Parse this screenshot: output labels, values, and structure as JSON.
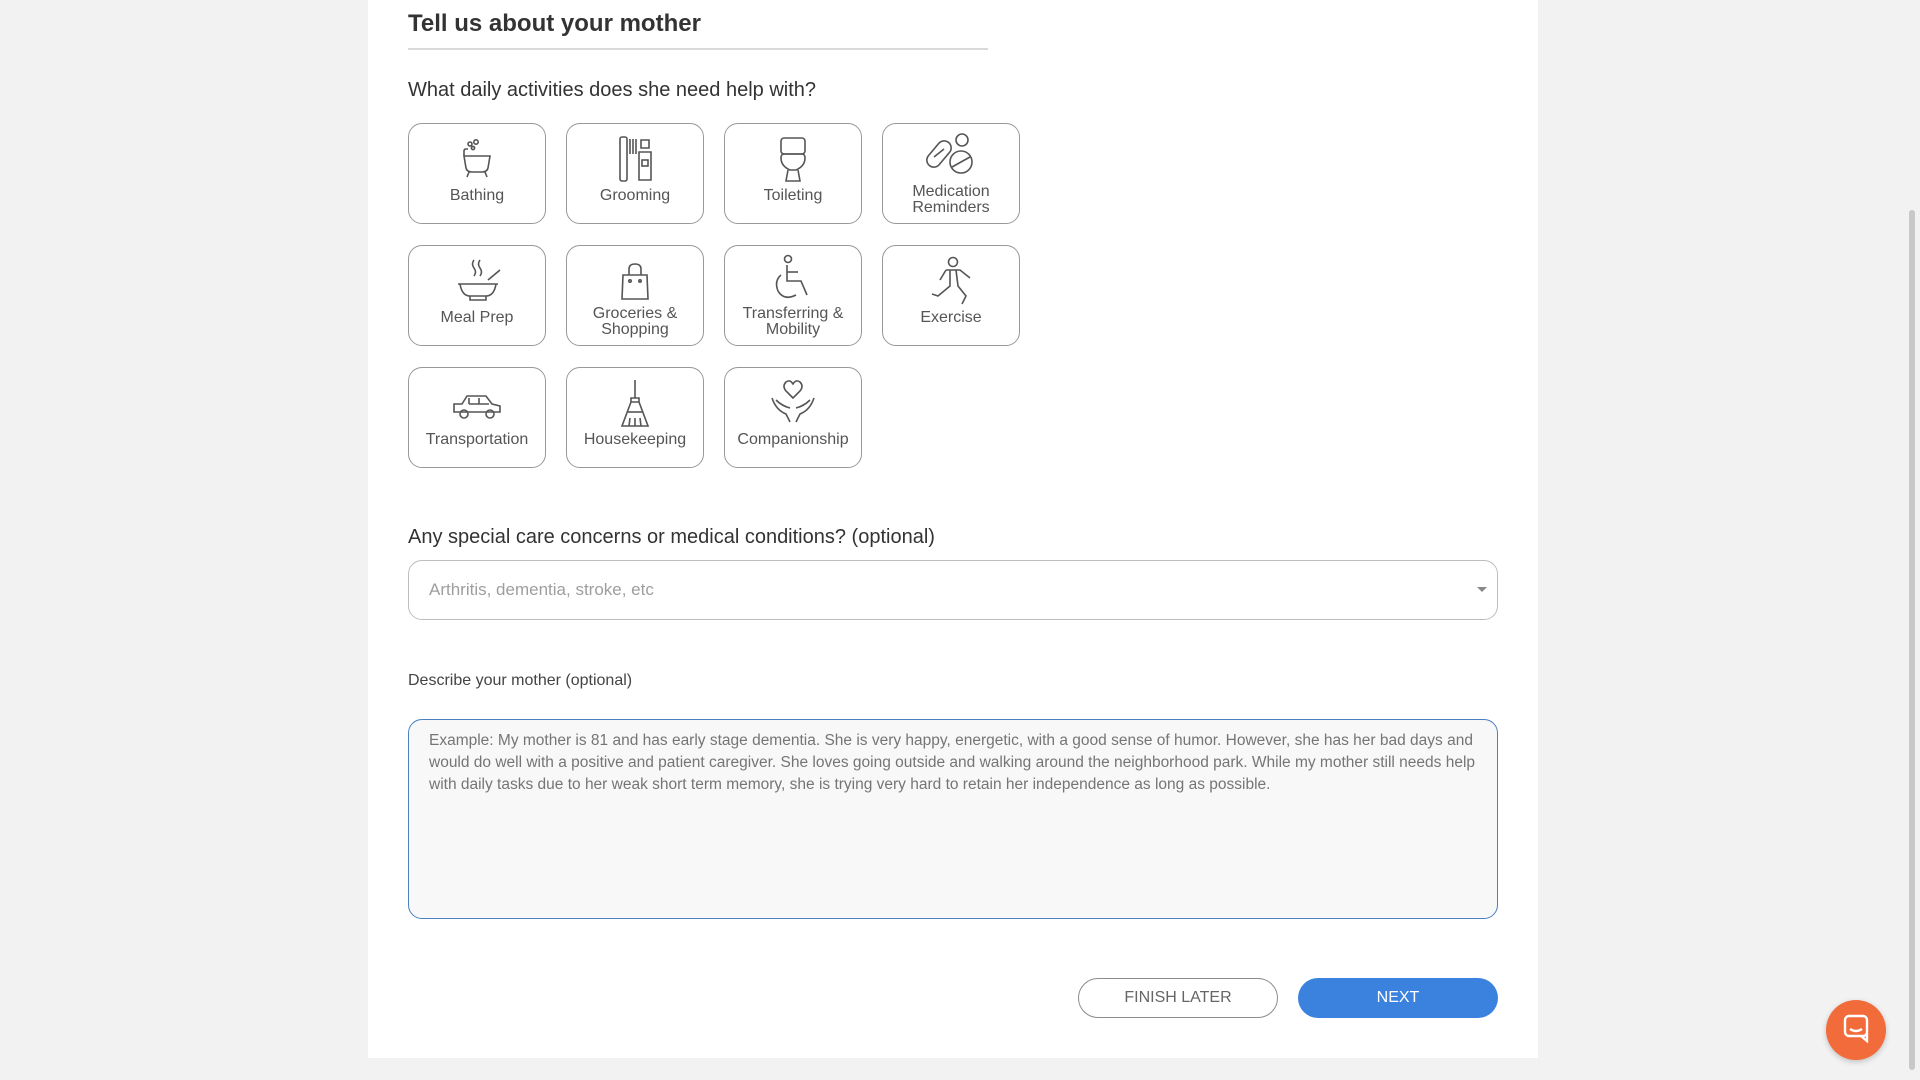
{
  "form": {
    "section_title": "Tell us about your mother",
    "activities_question": "What daily activities does she need help with?",
    "activities": [
      {
        "label": "Bathing",
        "icon": "bathtub-icon"
      },
      {
        "label": "Grooming",
        "icon": "toothbrush-icon"
      },
      {
        "label": "Toileting",
        "icon": "toilet-icon"
      },
      {
        "label": "Medication Reminders",
        "icon": "pills-icon"
      },
      {
        "label": "Meal Prep",
        "icon": "hot-bowl-icon"
      },
      {
        "label": "Groceries & Shopping",
        "icon": "shopping-bag-icon"
      },
      {
        "label": "Transferring & Mobility",
        "icon": "wheelchair-icon"
      },
      {
        "label": "Exercise",
        "icon": "exercise-icon"
      },
      {
        "label": "Transportation",
        "icon": "car-icon"
      },
      {
        "label": "Housekeeping",
        "icon": "broom-icon"
      },
      {
        "label": "Companionship",
        "icon": "heart-hands-icon"
      }
    ],
    "concerns_label": "Any special care concerns or medical conditions? (optional)",
    "concerns_placeholder": "Arthritis, dementia, stroke, etc",
    "describe_label": "Describe your mother (optional)",
    "describe_placeholder": "Example: My mother is 81 and has early stage dementia. She is very happy, energetic, with a good sense of humor. However, she has her bad days and would do well with a positive and patient caregiver. She loves going outside and walking around the neighborhood park. While my mother still needs help with daily tasks due to her weak short term memory, she is trying very hard to retain her independence as long as possible.",
    "finish_later_label": "FINISH LATER",
    "next_label": "NEXT"
  },
  "colors": {
    "primary": "#3b82de",
    "chat_button": "#f26b3a",
    "focus_border": "#4a7fc1"
  },
  "chat": {
    "icon": "chat-bubble-icon"
  }
}
